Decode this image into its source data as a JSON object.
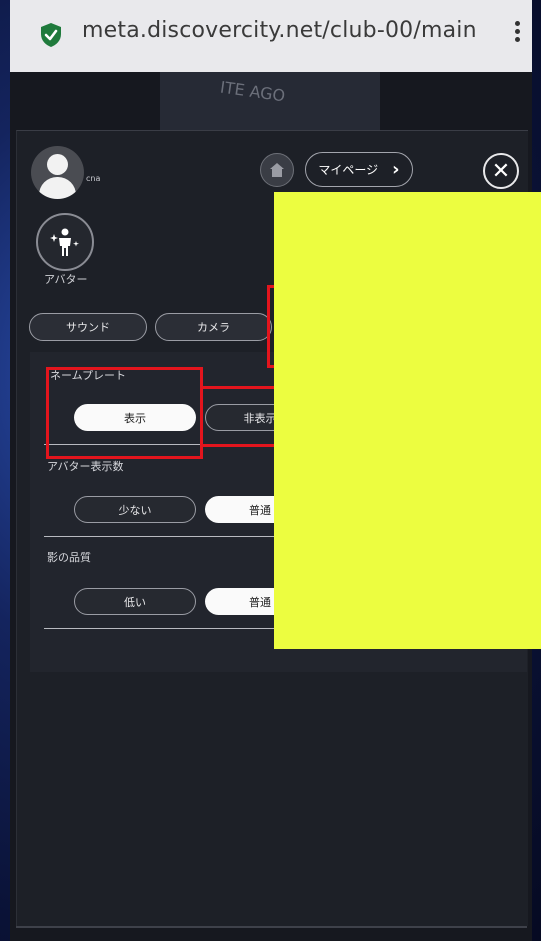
{
  "browser": {
    "url": "meta.discovercity.net/club-00/main"
  },
  "scene": {
    "wall_text": "ITE AGO"
  },
  "profile": {
    "username": "cna",
    "avatar_button_label": "アバター"
  },
  "header": {
    "mypage_label": "マイページ",
    "mypage_chevron": "›",
    "close_glyph": "✕"
  },
  "tabs": [
    {
      "label": "サウンド"
    },
    {
      "label": "カメラ"
    }
  ],
  "settings": {
    "nameplate": {
      "label": "ネームプレート",
      "options": [
        "表示",
        "非表示"
      ],
      "selected": "表示"
    },
    "avatar_count": {
      "label": "アバター表示数",
      "options": [
        "少ない",
        "普通"
      ],
      "selected": "普通"
    },
    "shadow_quality": {
      "label": "影の品質",
      "options": [
        "低い",
        "普通"
      ],
      "selected": "普通"
    }
  },
  "overlay": {
    "highlight_color": "#e3151d",
    "redaction_color": "#ecfd40"
  },
  "icons": [
    "shield-check-icon",
    "kebab-menu-icon",
    "user-avatar-icon",
    "avatar-sparkle-icon",
    "home-icon",
    "chevron-right-icon",
    "close-icon"
  ]
}
